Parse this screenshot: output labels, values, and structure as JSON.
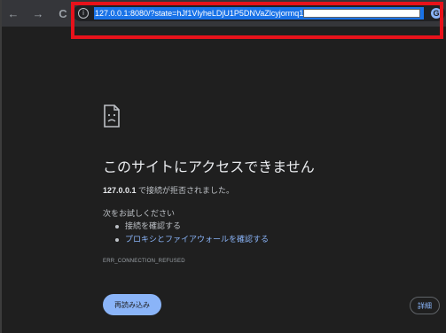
{
  "toolbar": {
    "back_icon": "←",
    "forward_icon": "→",
    "reload_icon": "C",
    "info_icon": "i",
    "url": "127.0.0.1:8080/?state=hJf1VlyheLDjU1P5DNVaZlcyjormq1&",
    "extension_icon": "G"
  },
  "error_page": {
    "heading": "このサイトにアクセスできません",
    "host": "127.0.0.1",
    "message": " で接続が拒否されました。",
    "try_label": "次をお試しください",
    "suggestions": [
      "接続を確認する",
      "プロキシとファイアウォールを確認する"
    ],
    "error_code": "ERR_CONNECTION_REFUSED",
    "reload_label": "再読み込み",
    "details_label": "詳細"
  },
  "colors": {
    "background": "#1f1f1f",
    "link": "#8ab4f8",
    "highlight_box": "#e8121b",
    "url_selection": "#1a73e8"
  }
}
